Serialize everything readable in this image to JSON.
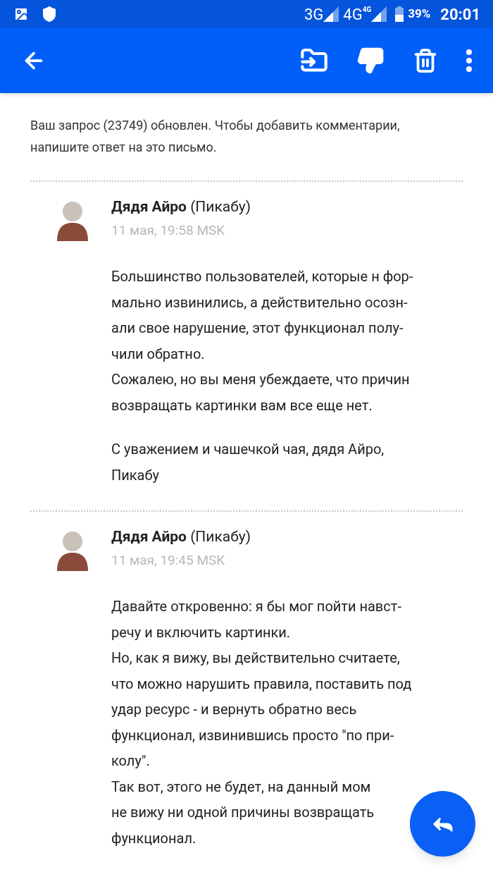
{
  "status_bar": {
    "network_1": "3G",
    "network_2": "4G",
    "network_2_badge": "4G",
    "battery_level": "39%",
    "time": "20:01"
  },
  "notice": "Ваш запрос (23749) обновлен. Чтобы добавить комментарии, напишите ответ на это письмо.",
  "messages": [
    {
      "author": "Дядя Айро",
      "source": "(Пикабу)",
      "date": "11 мая, 19:58 MSK",
      "paragraphs": [
        {
          "lines": [
            "Большинство пользователей, которые н фор-",
            "мально извинились, а действительно осозн-",
            "али свое нарушение, этот функционал полу-",
            "чили обратно.",
            "Сожалею, но вы меня убеждаете, что причин",
            "возвращать картинки вам все еще нет."
          ]
        },
        {
          "lines": [
            "С уважением и чашечкой чая, дядя Айро,",
            "Пикабу"
          ]
        }
      ]
    },
    {
      "author": "Дядя Айро",
      "source": "(Пикабу)",
      "date": "11 мая, 19:45 MSK",
      "paragraphs": [
        {
          "lines": [
            "Давайте откровенно: я бы мог пойти навст-",
            "речу и включить картинки.",
            "Но, как я вижу, вы действительно считаете,",
            "что можно нарушить правила, поставить под",
            "удар ресурс - и вернуть обратно весь",
            "функционал, извинившись просто \"по при-",
            "колу\".",
            "Так вот, этого не будет, на данный мом",
            "не вижу ни одной причины возвращать",
            "функционал."
          ]
        }
      ]
    }
  ]
}
